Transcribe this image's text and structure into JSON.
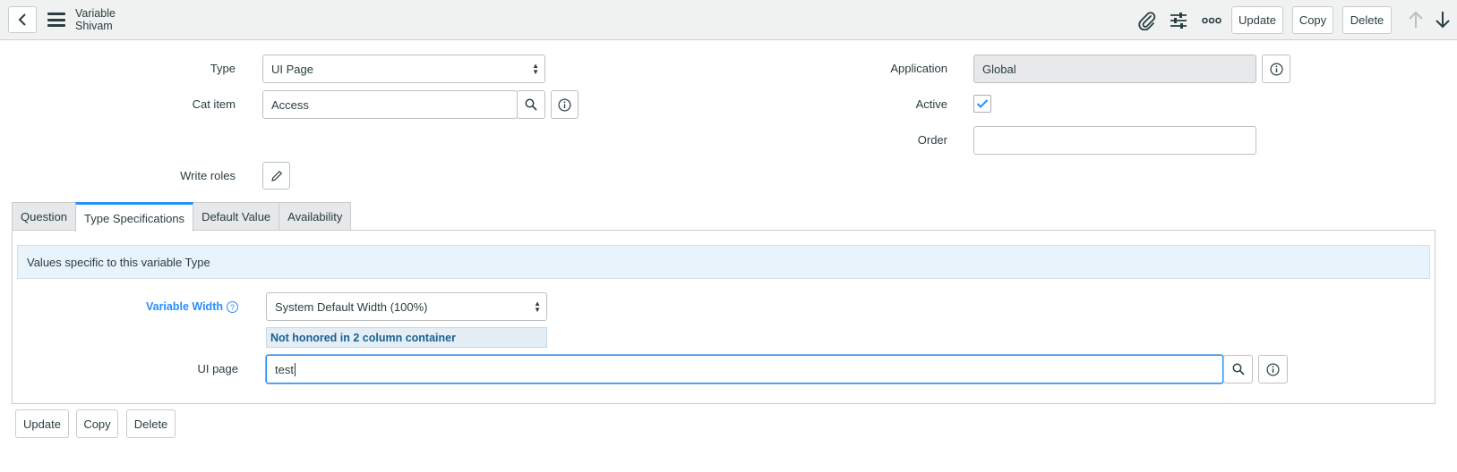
{
  "header": {
    "title_line1": "Variable",
    "title_line2": "Shivam",
    "update_label": "Update",
    "copy_label": "Copy",
    "delete_label": "Delete"
  },
  "form": {
    "type_label": "Type",
    "type_value": "UI Page",
    "cat_item_label": "Cat item",
    "cat_item_value": "Access",
    "write_roles_label": "Write roles",
    "application_label": "Application",
    "application_value": "Global",
    "active_label": "Active",
    "active_checked": true,
    "order_label": "Order",
    "order_value": ""
  },
  "tabs": [
    {
      "label": "Question",
      "active": false
    },
    {
      "label": "Type Specifications",
      "active": true
    },
    {
      "label": "Default Value",
      "active": false
    },
    {
      "label": "Availability",
      "active": false
    }
  ],
  "type_spec": {
    "info_text": "Values specific to this variable Type",
    "variable_width_label": "Variable Width",
    "variable_width_value": "System Default Width (100%)",
    "note": "Not honored in 2 column container",
    "ui_page_label": "UI page",
    "ui_page_value": "test"
  },
  "footer": {
    "update_label": "Update",
    "copy_label": "Copy",
    "delete_label": "Delete"
  },
  "colors": {
    "accent": "#278efc",
    "header_bg": "#f0f1f1",
    "info_bg": "#e8f3fb"
  }
}
